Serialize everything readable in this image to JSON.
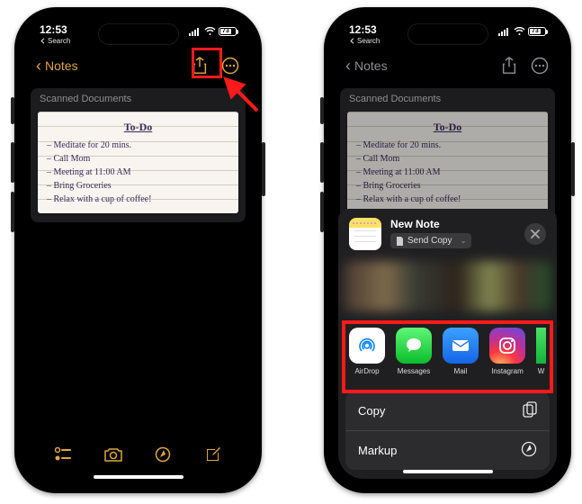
{
  "status": {
    "time": "12:53",
    "search_label": "Search",
    "battery": "73"
  },
  "nav": {
    "back_label": "Notes"
  },
  "document": {
    "header": "Scanned Documents",
    "title": "To-Do",
    "lines": [
      "– Meditate for 20 mins.",
      "– Call Mom",
      "– Meeting at 11:00 AM",
      "– Bring Groceries",
      "– Relax with a cup of coffee!"
    ]
  },
  "share": {
    "title": "New Note",
    "send_label": "Send Copy",
    "apps": {
      "airdrop": "AirDrop",
      "messages": "Messages",
      "mail": "Mail",
      "instagram": "Instagram",
      "whatsapp": "WhatsApp"
    },
    "actions": {
      "copy": "Copy",
      "markup": "Markup"
    }
  }
}
